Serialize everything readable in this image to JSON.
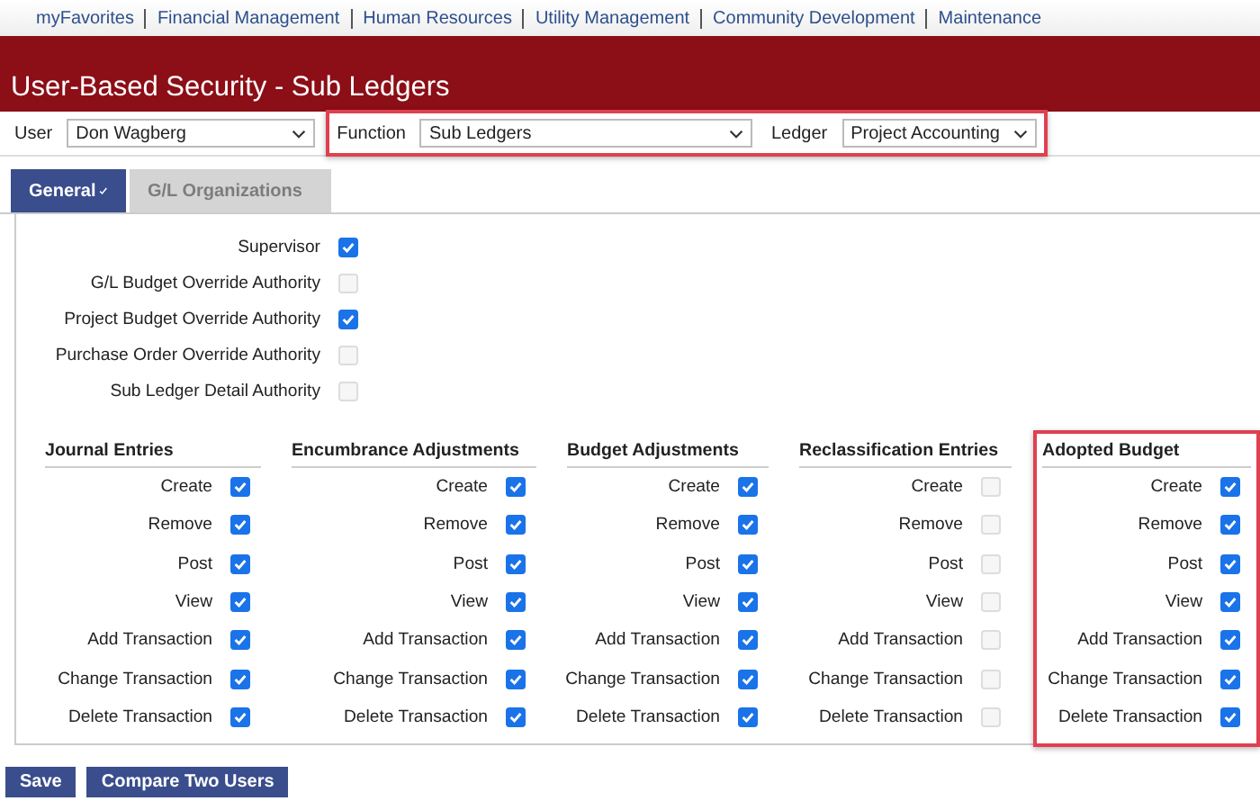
{
  "nav": [
    "myFavorites",
    "Financial Management",
    "Human Resources",
    "Utility Management",
    "Community Development",
    "Maintenance"
  ],
  "title": "User-Based Security - Sub Ledgers",
  "filters": {
    "highlighted": true,
    "user": {
      "label": "User",
      "value": "Don Wagberg"
    },
    "function": {
      "label": "Function",
      "value": "Sub Ledgers"
    },
    "ledger": {
      "label": "Ledger",
      "value": "Project Accounting"
    }
  },
  "tabs": [
    {
      "label": "General",
      "selected": true,
      "valid": true
    },
    {
      "label": "G/L Organizations",
      "selected": false,
      "valid": false
    }
  ],
  "authorities": [
    {
      "label": "Supervisor",
      "checked": true
    },
    {
      "label": "G/L Budget Override Authority",
      "checked": false
    },
    {
      "label": "Project Budget Override Authority",
      "checked": true
    },
    {
      "label": "Purchase Order Override Authority",
      "checked": false
    },
    {
      "label": "Sub Ledger Detail Authority",
      "checked": false
    }
  ],
  "sections": [
    {
      "title": "Journal Entries",
      "highlighted": false,
      "items": [
        {
          "label": "Create",
          "checked": true
        },
        {
          "label": "Remove",
          "checked": true
        },
        {
          "label": "Post",
          "checked": true
        },
        {
          "label": "View",
          "checked": true
        },
        {
          "label": "Add Transaction",
          "checked": true
        },
        {
          "label": "Change Transaction",
          "checked": true
        },
        {
          "label": "Delete Transaction",
          "checked": true
        }
      ]
    },
    {
      "title": "Encumbrance Adjustments",
      "highlighted": false,
      "items": [
        {
          "label": "Create",
          "checked": true
        },
        {
          "label": "Remove",
          "checked": true
        },
        {
          "label": "Post",
          "checked": true
        },
        {
          "label": "View",
          "checked": true
        },
        {
          "label": "Add Transaction",
          "checked": true
        },
        {
          "label": "Change Transaction",
          "checked": true
        },
        {
          "label": "Delete Transaction",
          "checked": true
        }
      ]
    },
    {
      "title": "Budget Adjustments",
      "highlighted": false,
      "items": [
        {
          "label": "Create",
          "checked": true
        },
        {
          "label": "Remove",
          "checked": true
        },
        {
          "label": "Post",
          "checked": true
        },
        {
          "label": "View",
          "checked": true
        },
        {
          "label": "Add Transaction",
          "checked": true
        },
        {
          "label": "Change Transaction",
          "checked": true
        },
        {
          "label": "Delete Transaction",
          "checked": true
        }
      ]
    },
    {
      "title": "Reclassification Entries",
      "highlighted": false,
      "items": [
        {
          "label": "Create",
          "checked": false
        },
        {
          "label": "Remove",
          "checked": false
        },
        {
          "label": "Post",
          "checked": false
        },
        {
          "label": "View",
          "checked": false
        },
        {
          "label": "Add Transaction",
          "checked": false
        },
        {
          "label": "Change Transaction",
          "checked": false
        },
        {
          "label": "Delete Transaction",
          "checked": false
        }
      ]
    },
    {
      "title": "Adopted Budget",
      "highlighted": true,
      "items": [
        {
          "label": "Create",
          "checked": true
        },
        {
          "label": "Remove",
          "checked": true
        },
        {
          "label": "Post",
          "checked": true
        },
        {
          "label": "View",
          "checked": true
        },
        {
          "label": "Add Transaction",
          "checked": true
        },
        {
          "label": "Change Transaction",
          "checked": true
        },
        {
          "label": "Delete Transaction",
          "checked": true
        }
      ]
    }
  ],
  "buttons": [
    "Save",
    "Compare Two Users"
  ]
}
